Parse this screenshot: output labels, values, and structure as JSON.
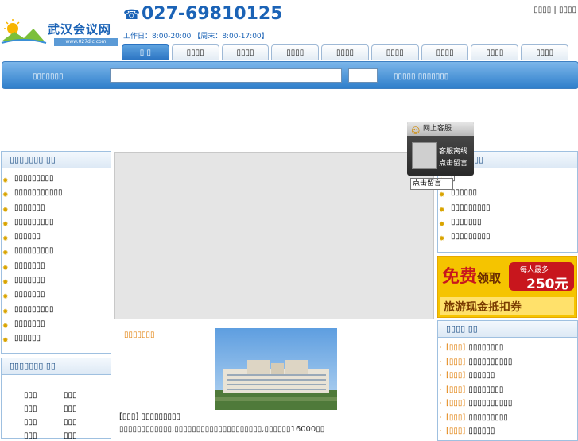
{
  "header": {
    "logo_text": "武汉会议网",
    "logo_url": "www.027djc.com",
    "phone": "027-69810125",
    "hours": "工作日：8:00-20:00 【周末：8:00-17:00】",
    "top_links": [
      "▯▯▯▯",
      "▯▯▯▯"
    ],
    "top_sep": "|"
  },
  "nav": {
    "tabs": [
      "▯ ▯",
      "▯▯▯▯",
      "▯▯▯▯",
      "▯▯▯▯",
      "▯▯▯▯",
      "▯▯▯▯",
      "▯▯▯▯",
      "▯▯▯▯",
      "▯▯▯▯"
    ],
    "active_index": 0
  },
  "search": {
    "label": "▯▯▯▯▯▯▯",
    "input_value": "",
    "button_label": "",
    "right_text": "▯▯▯▯▯ ▯▯▯▯▯▯▯"
  },
  "left_panel_1": {
    "title": "▯▯▯▯▯▯▯ ▯▯",
    "items": [
      "▯▯▯▯▯▯▯▯▯",
      "▯▯▯▯▯▯▯▯▯▯▯",
      "▯▯▯▯▯▯▯",
      "▯▯▯▯▯▯▯▯▯",
      "▯▯▯▯▯▯",
      "▯▯▯▯▯▯▯▯▯",
      "▯▯▯▯▯▯▯",
      "▯▯▯▯▯▯▯",
      "▯▯▯▯▯▯▯",
      "▯▯▯▯▯▯▯▯▯",
      "▯▯▯▯▯▯▯",
      "▯▯▯▯▯▯"
    ]
  },
  "left_panel_2": {
    "title": "▯▯▯▯▯▯▯ ▯▯",
    "items": [
      "▯▯▯",
      "▯▯▯",
      "▯▯▯",
      "▯▯▯",
      "▯▯▯",
      "▯▯▯",
      "▯▯▯",
      "▯▯▯"
    ]
  },
  "center": {
    "hotel_title": "▯▯▯▯▯▯▯",
    "hotel_tag": "[▯▯▯]",
    "hotel_link": "▯▯▯▯▯▯▯▯▯",
    "hotel_desc": "▯▯▯▯▯▯▯▯▯▯▯▯,▯▯▯▯▯▯▯▯▯▯▯▯▯▯▯▯▯▯▯▯,▯▯▯▯▯▯16000▯▯"
  },
  "customer_service": {
    "title": "网上客服",
    "line1": "客服离线",
    "line2": "点击留言",
    "tooltip": "点击留言"
  },
  "right_panel_1": {
    "title": "▯▯",
    "items": [
      "▯",
      "▯▯▯▯▯▯",
      "▯▯▯▯▯▯▯▯▯",
      "▯▯▯▯▯▯▯",
      "▯▯▯▯▯▯▯▯▯"
    ]
  },
  "ad": {
    "big": "免费",
    "big2": "领取",
    "each": "每人最多",
    "amount": "250元",
    "sub": "旅游现金抵扣券"
  },
  "right_panel_2": {
    "title": "▯▯▯▯ ▯▯",
    "tag": "[▯▯▯]",
    "items": [
      "▯▯▯▯▯▯▯▯",
      "▯▯▯▯▯▯▯▯▯▯",
      "▯▯▯▯▯▯",
      "▯▯▯▯▯▯▯▯",
      "▯▯▯▯▯▯▯▯▯▯",
      "▯▯▯▯▯▯▯▯▯",
      "▯▯▯▯▯▯"
    ]
  },
  "colors": {
    "brand_blue": "#1b63b6",
    "accent_orange": "#e07b00",
    "searchbar_blue": "#2f7fcb"
  }
}
